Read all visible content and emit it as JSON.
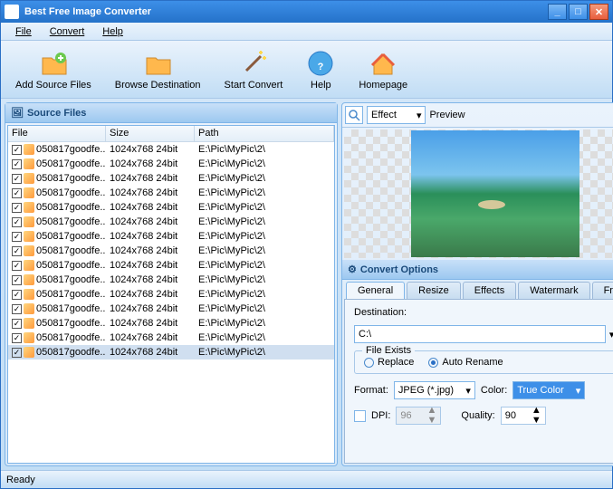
{
  "title": "Best Free Image Converter",
  "menu": {
    "file": "File",
    "convert": "Convert",
    "help": "Help"
  },
  "toolbar": {
    "add": "Add Source Files",
    "browse": "Browse Destination",
    "start": "Start Convert",
    "help": "Help",
    "home": "Homepage"
  },
  "source_panel": "Source Files",
  "columns": {
    "file": "File",
    "size": "Size",
    "path": "Path"
  },
  "rows": [
    {
      "file": "050817goodfe...",
      "size": "1024x768  24bit",
      "path": "E:\\Pic\\MyPic\\2\\"
    },
    {
      "file": "050817goodfe...",
      "size": "1024x768  24bit",
      "path": "E:\\Pic\\MyPic\\2\\"
    },
    {
      "file": "050817goodfe...",
      "size": "1024x768  24bit",
      "path": "E:\\Pic\\MyPic\\2\\"
    },
    {
      "file": "050817goodfe...",
      "size": "1024x768  24bit",
      "path": "E:\\Pic\\MyPic\\2\\"
    },
    {
      "file": "050817goodfe...",
      "size": "1024x768  24bit",
      "path": "E:\\Pic\\MyPic\\2\\"
    },
    {
      "file": "050817goodfe...",
      "size": "1024x768  24bit",
      "path": "E:\\Pic\\MyPic\\2\\"
    },
    {
      "file": "050817goodfe...",
      "size": "1024x768  24bit",
      "path": "E:\\Pic\\MyPic\\2\\"
    },
    {
      "file": "050817goodfe...",
      "size": "1024x768  24bit",
      "path": "E:\\Pic\\MyPic\\2\\"
    },
    {
      "file": "050817goodfe...",
      "size": "1024x768  24bit",
      "path": "E:\\Pic\\MyPic\\2\\"
    },
    {
      "file": "050817goodfe...",
      "size": "1024x768  24bit",
      "path": "E:\\Pic\\MyPic\\2\\"
    },
    {
      "file": "050817goodfe...",
      "size": "1024x768  24bit",
      "path": "E:\\Pic\\MyPic\\2\\"
    },
    {
      "file": "050817goodfe...",
      "size": "1024x768  24bit",
      "path": "E:\\Pic\\MyPic\\2\\"
    },
    {
      "file": "050817goodfe...",
      "size": "1024x768  24bit",
      "path": "E:\\Pic\\MyPic\\2\\"
    },
    {
      "file": "050817goodfe...",
      "size": "1024x768  24bit",
      "path": "E:\\Pic\\MyPic\\2\\"
    },
    {
      "file": "050817goodfe...",
      "size": "1024x768  24bit",
      "path": "E:\\Pic\\MyPic\\2\\"
    }
  ],
  "effect": {
    "label": "Effect",
    "preview": "Preview"
  },
  "options_panel": "Convert Options",
  "tabs": {
    "general": "General",
    "resize": "Resize",
    "effects": "Effects",
    "watermark": "Watermark",
    "frame": "Frame"
  },
  "dest": {
    "label": "Destination:",
    "value": "C:\\"
  },
  "file_exists": {
    "legend": "File Exists",
    "replace": "Replace",
    "auto": "Auto Rename"
  },
  "format": {
    "label": "Format:",
    "value": "JPEG (*.jpg)"
  },
  "color": {
    "label": "Color:",
    "value": "True Color"
  },
  "dpi": {
    "label": "DPI:",
    "value": "96"
  },
  "quality": {
    "label": "Quality:",
    "value": "90"
  },
  "status": "Ready"
}
